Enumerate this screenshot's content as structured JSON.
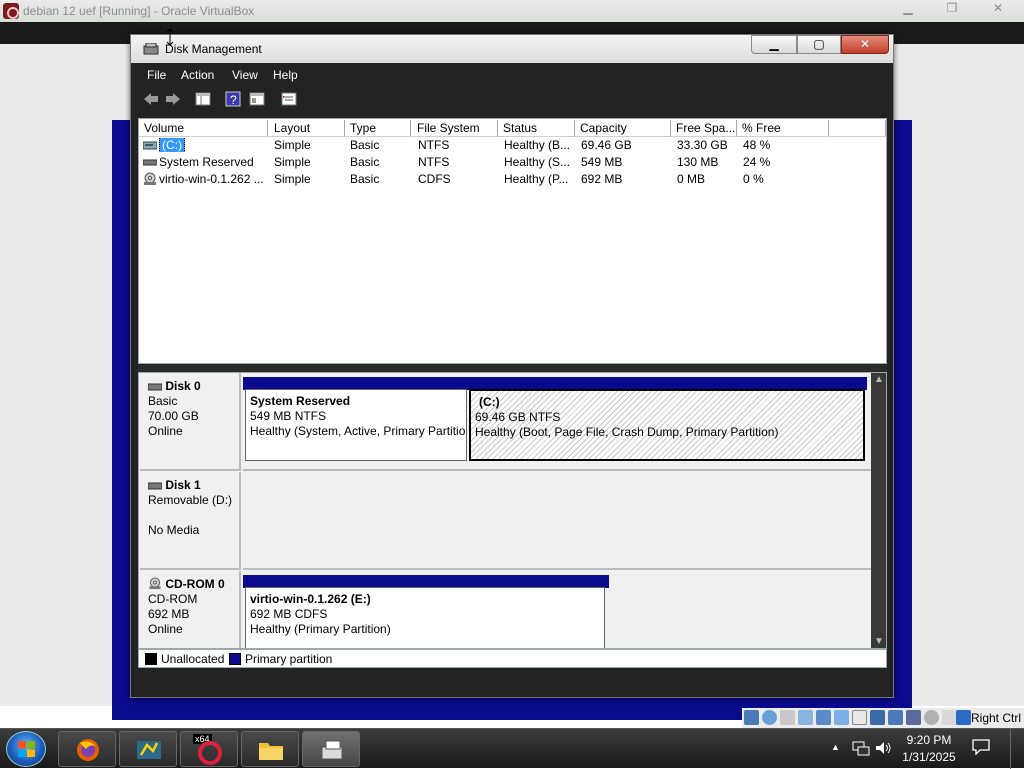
{
  "host": {
    "title": "debian 12 uef [Running] - Oracle VirtualBox",
    "right_ctrl": "Right Ctrl"
  },
  "window": {
    "title": "Disk Management",
    "min_glyph": "▁",
    "max_glyph": "▢",
    "close_glyph": "✕"
  },
  "menu": {
    "file": "File",
    "action": "Action",
    "view": "View",
    "help": "Help"
  },
  "volume_table": {
    "columns": [
      "Volume",
      "Layout",
      "Type",
      "File System",
      "Status",
      "Capacity",
      "Free Spa...",
      "% Free"
    ],
    "rows": [
      {
        "volume": "(C:)",
        "layout": "Simple",
        "type": "Basic",
        "fs": "NTFS",
        "status": "Healthy (B...",
        "capacity": "69.46 GB",
        "free": "33.30 GB",
        "pct": "48 %"
      },
      {
        "volume": "System Reserved",
        "layout": "Simple",
        "type": "Basic",
        "fs": "NTFS",
        "status": "Healthy (S...",
        "capacity": "549 MB",
        "free": "130 MB",
        "pct": "24 %"
      },
      {
        "volume": "virtio-win-0.1.262 ...",
        "layout": "Simple",
        "type": "Basic",
        "fs": "CDFS",
        "status": "Healthy (P...",
        "capacity": "692 MB",
        "free": "0 MB",
        "pct": "0 %"
      }
    ]
  },
  "disks": {
    "disk0": {
      "name": "Disk 0",
      "type": "Basic",
      "size": "70.00 GB",
      "state": "Online",
      "part1": {
        "name": "System Reserved",
        "size": "549 MB NTFS",
        "status": "Healthy (System, Active, Primary Partition)"
      },
      "part2": {
        "name": "(C:)",
        "size": "69.46 GB NTFS",
        "status": "Healthy (Boot, Page File, Crash Dump, Primary Partition)"
      }
    },
    "disk1": {
      "name": "Disk 1",
      "type": "Removable (D:)",
      "state": "No Media"
    },
    "cdrom0": {
      "name": "CD-ROM 0",
      "type": "CD-ROM",
      "size": "692 MB",
      "state": "Online",
      "part1": {
        "name": "virtio-win-0.1.262  (E:)",
        "size": "692 MB CDFS",
        "status": "Healthy (Primary Partition)"
      }
    }
  },
  "legend": {
    "unallocated": "Unallocated",
    "primary": "Primary partition"
  },
  "taskbar": {
    "time": "9:20 PM",
    "date": "1/31/2025",
    "x64_badge": "x64"
  },
  "colors": {
    "primary_partition": "#0a0a8c",
    "selection": "#3399ff",
    "close_button": "#c0402a"
  }
}
